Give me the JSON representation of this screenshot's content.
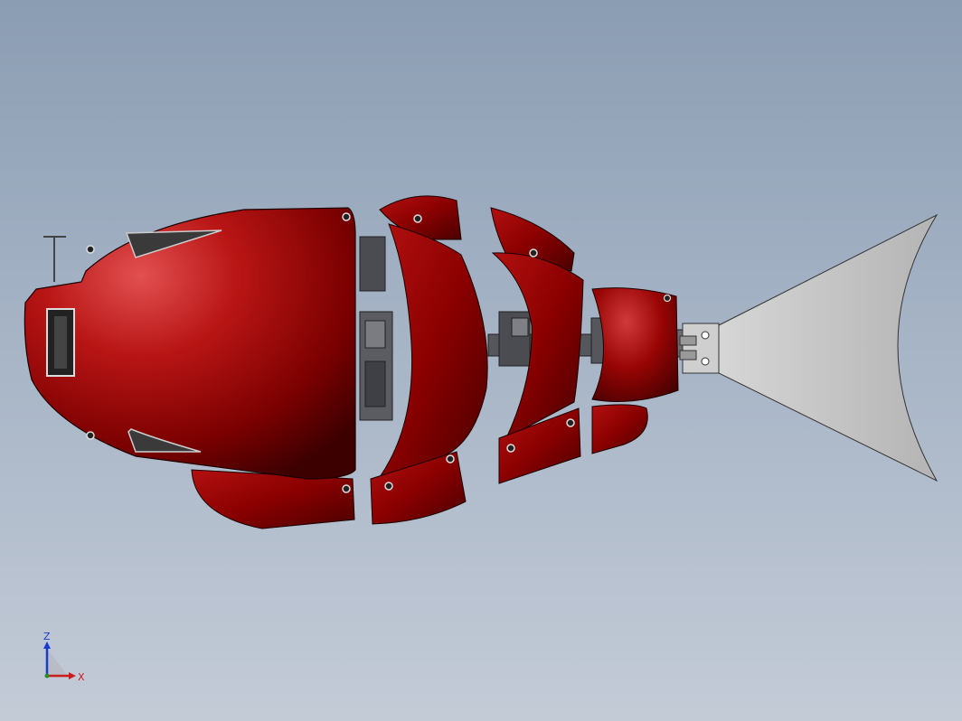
{
  "viewport": {
    "background_top": "#8b9db3",
    "background_bottom": "#c3cbd7"
  },
  "model": {
    "body_color": "#8a0000",
    "body_highlight": "#e25050",
    "mechanism_color": "#4a4c52",
    "tail_fin_color": "#c2c2c2"
  },
  "triad": {
    "z_label": "Z",
    "x_label": "X",
    "z_color": "#1a3ccc",
    "x_color": "#cc1a1a"
  }
}
